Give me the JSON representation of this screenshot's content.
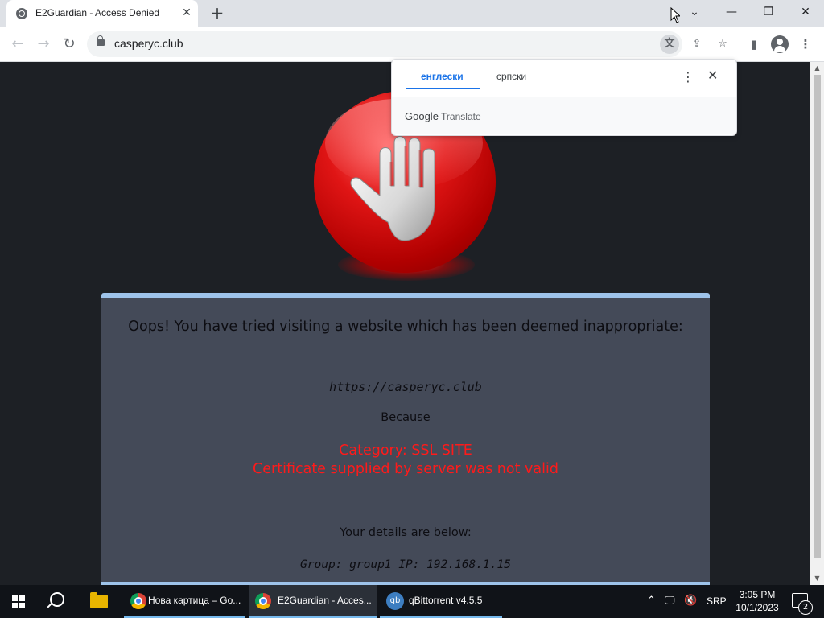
{
  "browser": {
    "tab_title": "E2Guardian - Access Denied",
    "tab_close": "✕",
    "new_tab": "+",
    "url": "casperyc.club",
    "back": "←",
    "forward": "→",
    "reload": "↻",
    "window": {
      "minimize": "—",
      "restore": "❐",
      "close": "✕",
      "tab_search": "⌄"
    }
  },
  "translate_popup": {
    "source_lang": "енглески",
    "target_lang": "српски",
    "menu": "⋮",
    "close": "✕",
    "brand": "Google",
    "product": "Translate"
  },
  "block_page": {
    "heading": "Oops! You have tried visiting a website which has been deemed inappropriate:",
    "blocked_url": "https://casperyc.club",
    "because": "Because",
    "category": "Category: SSL SITE",
    "reason": "Certificate supplied by server was not valid",
    "details_heading": "Your details are below:",
    "details": "Group: group1   IP: 192.168.1.15"
  },
  "taskbar": {
    "items": [
      {
        "label": "Нова картица – Go..."
      },
      {
        "label": "E2Guardian - Acces..."
      },
      {
        "label": "qBittorrent v4.5.5"
      }
    ],
    "qb_icon": "qb",
    "language": "SRP",
    "time": "3:05 PM",
    "date": "10/1/2023",
    "notifications": "2"
  },
  "colors": {
    "page_bg": "#1d2025",
    "panel_bg": "#444a58",
    "panel_border": "#9ec3ea",
    "reason_red": "#ff1a1a",
    "accent_blue": "#1a73e8"
  }
}
